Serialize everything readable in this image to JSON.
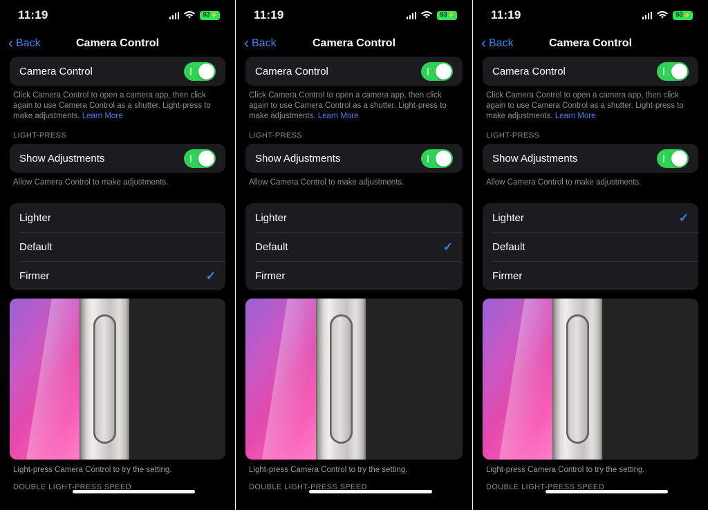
{
  "meta": {
    "accent_blue": "#3b82f7",
    "toggle_green": "#2fd257",
    "card_bg": "#1c1c1e",
    "secondary_text": "#8d8d92"
  },
  "status_bar": {
    "time": "11:19",
    "cellular_icon": "cellular-bars-icon",
    "wifi_icon": "wifi-icon",
    "battery_percent": "93",
    "battery_charging_glyph": "⚡",
    "battery_icon": "battery-charging-icon"
  },
  "nav": {
    "back_label": "Back",
    "back_icon": "chevron-left-icon",
    "title": "Camera Control"
  },
  "main_toggle": {
    "label": "Camera Control",
    "enabled": true,
    "footnote_text": "Click Camera Control to open a camera app, then click again to use Camera Control as a shutter. Light-press to make adjustments. ",
    "footnote_link": "Learn More"
  },
  "light_press_section": {
    "header": "LIGHT-PRESS",
    "show_adjustments_label": "Show Adjustments",
    "show_adjustments_enabled": true,
    "show_adjustments_footnote": "Allow Camera Control to make adjustments."
  },
  "pressure_options": {
    "options": [
      "Lighter",
      "Default",
      "Firmer"
    ],
    "check_glyph": "✓"
  },
  "preview": {
    "caption": "Light-press Camera Control to try the setting.",
    "screen_name": "phone-screen-gradient",
    "button_name": "camera-control-button-illustration"
  },
  "bottom_section": {
    "label": "DOUBLE LIGHT-PRESS SPEED"
  },
  "panels": [
    {
      "id": "panel-firmer",
      "selected_option": "Firmer",
      "selected_index": 2
    },
    {
      "id": "panel-default",
      "selected_option": "Default",
      "selected_index": 1
    },
    {
      "id": "panel-lighter",
      "selected_option": "Lighter",
      "selected_index": 0
    }
  ]
}
